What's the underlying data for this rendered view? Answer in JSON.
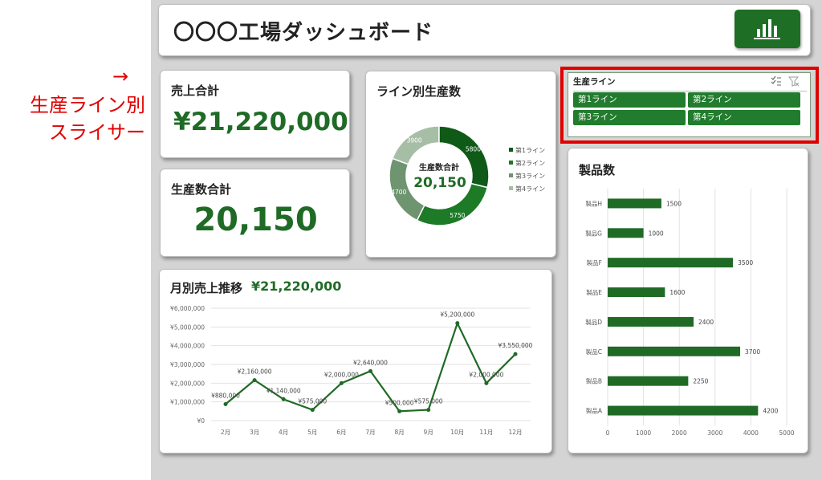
{
  "annotation": {
    "arrow": "→",
    "line1": "生産ライン別",
    "line2": "スライサー"
  },
  "header": {
    "title": "〇〇〇工場ダッシュボード",
    "icon": "bar-chart-icon"
  },
  "kpi_sales": {
    "label": "売上合計",
    "value": "¥21,220,000"
  },
  "kpi_production": {
    "label": "生産数合計",
    "value": "20,150"
  },
  "donut": {
    "title": "ライン別生産数",
    "center_label": "生産数合計",
    "center_value": "20,150",
    "labels": [
      "5800",
      "5750",
      "4700",
      "3900"
    ],
    "legend": [
      "第1ライン",
      "第2ライン",
      "第3ライン",
      "第4ライン"
    ]
  },
  "slicer": {
    "title": "生産ライン",
    "buttons": [
      "第1ライン",
      "第2ライン",
      "第3ライン",
      "第4ライン"
    ],
    "icons": [
      "multi-select-icon",
      "clear-filter-icon"
    ]
  },
  "monthly": {
    "title": "月別売上推移",
    "total": "¥21,220,000"
  },
  "products": {
    "title": "製品数"
  },
  "colors": {
    "accent": "#1f6b26",
    "highlight": "#e00000",
    "background": "#d4d4d4"
  },
  "chart_data": [
    {
      "type": "pie",
      "title": "ライン別生産数",
      "categories": [
        "第1ライン",
        "第2ライン",
        "第3ライン",
        "第4ライン"
      ],
      "values": [
        5800,
        5750,
        4700,
        3900
      ],
      "colors": [
        "#0f5a17",
        "#1d7a26",
        "#6f9470",
        "#a7bea6"
      ]
    },
    {
      "type": "line",
      "title": "月別売上推移",
      "categories": [
        "2月",
        "3月",
        "4月",
        "5月",
        "6月",
        "7月",
        "8月",
        "9月",
        "10月",
        "11月",
        "12月"
      ],
      "values": [
        880000,
        2160000,
        1140000,
        575000,
        2000000,
        2640000,
        500000,
        575000,
        5200000,
        2000000,
        3550000
      ],
      "data_labels": [
        "¥880,000",
        "¥2,160,000",
        "¥1,140,000",
        "¥575,000",
        "¥2,000,000",
        "¥2,640,000",
        "¥500,000",
        "¥575,000",
        "¥5,200,000",
        "¥2,000,000",
        "¥3,550,000"
      ],
      "y_ticks": [
        "¥0",
        "¥1,000,000",
        "¥2,000,000",
        "¥3,000,000",
        "¥4,000,000",
        "¥5,000,000",
        "¥6,000,000"
      ],
      "ylim": [
        0,
        6000000
      ],
      "grid": true
    },
    {
      "type": "bar",
      "title": "製品数",
      "categories": [
        "製品H",
        "製品G",
        "製品F",
        "製品E",
        "製品D",
        "製品C",
        "製品B",
        "製品A"
      ],
      "values": [
        1500,
        1000,
        3500,
        1600,
        2400,
        3700,
        2250,
        4200
      ],
      "x_ticks": [
        "0",
        "1000",
        "2000",
        "3000",
        "4000",
        "5000"
      ],
      "xlim": [
        0,
        5000
      ],
      "grid": true
    }
  ]
}
